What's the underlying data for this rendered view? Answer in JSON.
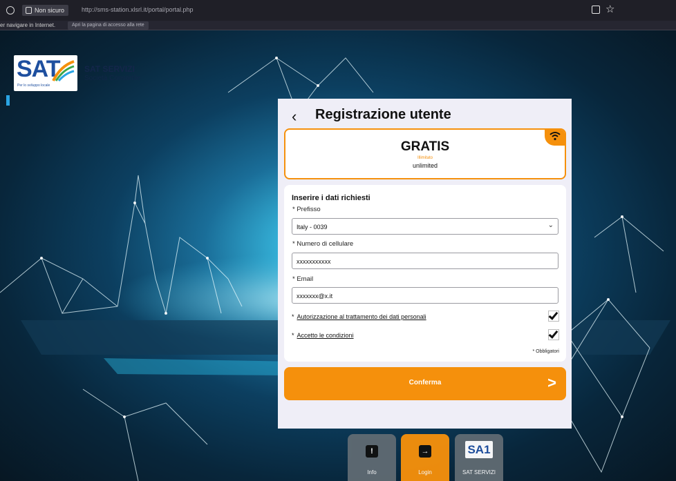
{
  "browser": {
    "security_label": "Non sicuro",
    "url": "http://sms-station.xlsrl.it/portal/portal.php",
    "notice_text": "er navigare in Internet.",
    "notice_button": "Apri la pagina di accesso alla rete"
  },
  "brand": {
    "logo_text": "SAT",
    "logo_tagline": "Per lo sviluppo locale",
    "company_name": "SAT SERVIZI",
    "company_sub": "Società Consortile",
    "color_blue": "#1e4f9f"
  },
  "panel": {
    "back_icon": "chevron-left-icon",
    "title": "Registrazione utente"
  },
  "plan": {
    "title": "GRATIS",
    "subtitle": "Illimitato",
    "note": "unlimited",
    "icon": "wifi-icon",
    "accent_color": "#f5900c"
  },
  "form": {
    "heading": "Inserire i dati richiesti",
    "prefisso_label": "* Prefisso",
    "prefisso_value": "Italy - 0039",
    "cellulare_label": "* Numero di cellulare",
    "cellulare_value": "xxxxxxxxxxx",
    "email_label": "* Email",
    "email_value": "xxxxxxx@x.it",
    "consent1_star": "*",
    "consent1_label": "Autorizzazione al trattamento dei dati personali",
    "consent1_checked": true,
    "consent2_star": "*",
    "consent2_label": "Accetto le condizioni",
    "consent2_checked": true,
    "required_note": "* Obbligatori"
  },
  "confirm": {
    "label": "Conferma",
    "arrow": ">"
  },
  "bottom_nav": [
    {
      "label": "Info",
      "icon": "info-icon",
      "active": false
    },
    {
      "label": "Login",
      "icon": "login-icon",
      "active": true
    },
    {
      "label": "SAT SERVIZI",
      "icon": "sat-logo-icon",
      "active": false
    }
  ]
}
